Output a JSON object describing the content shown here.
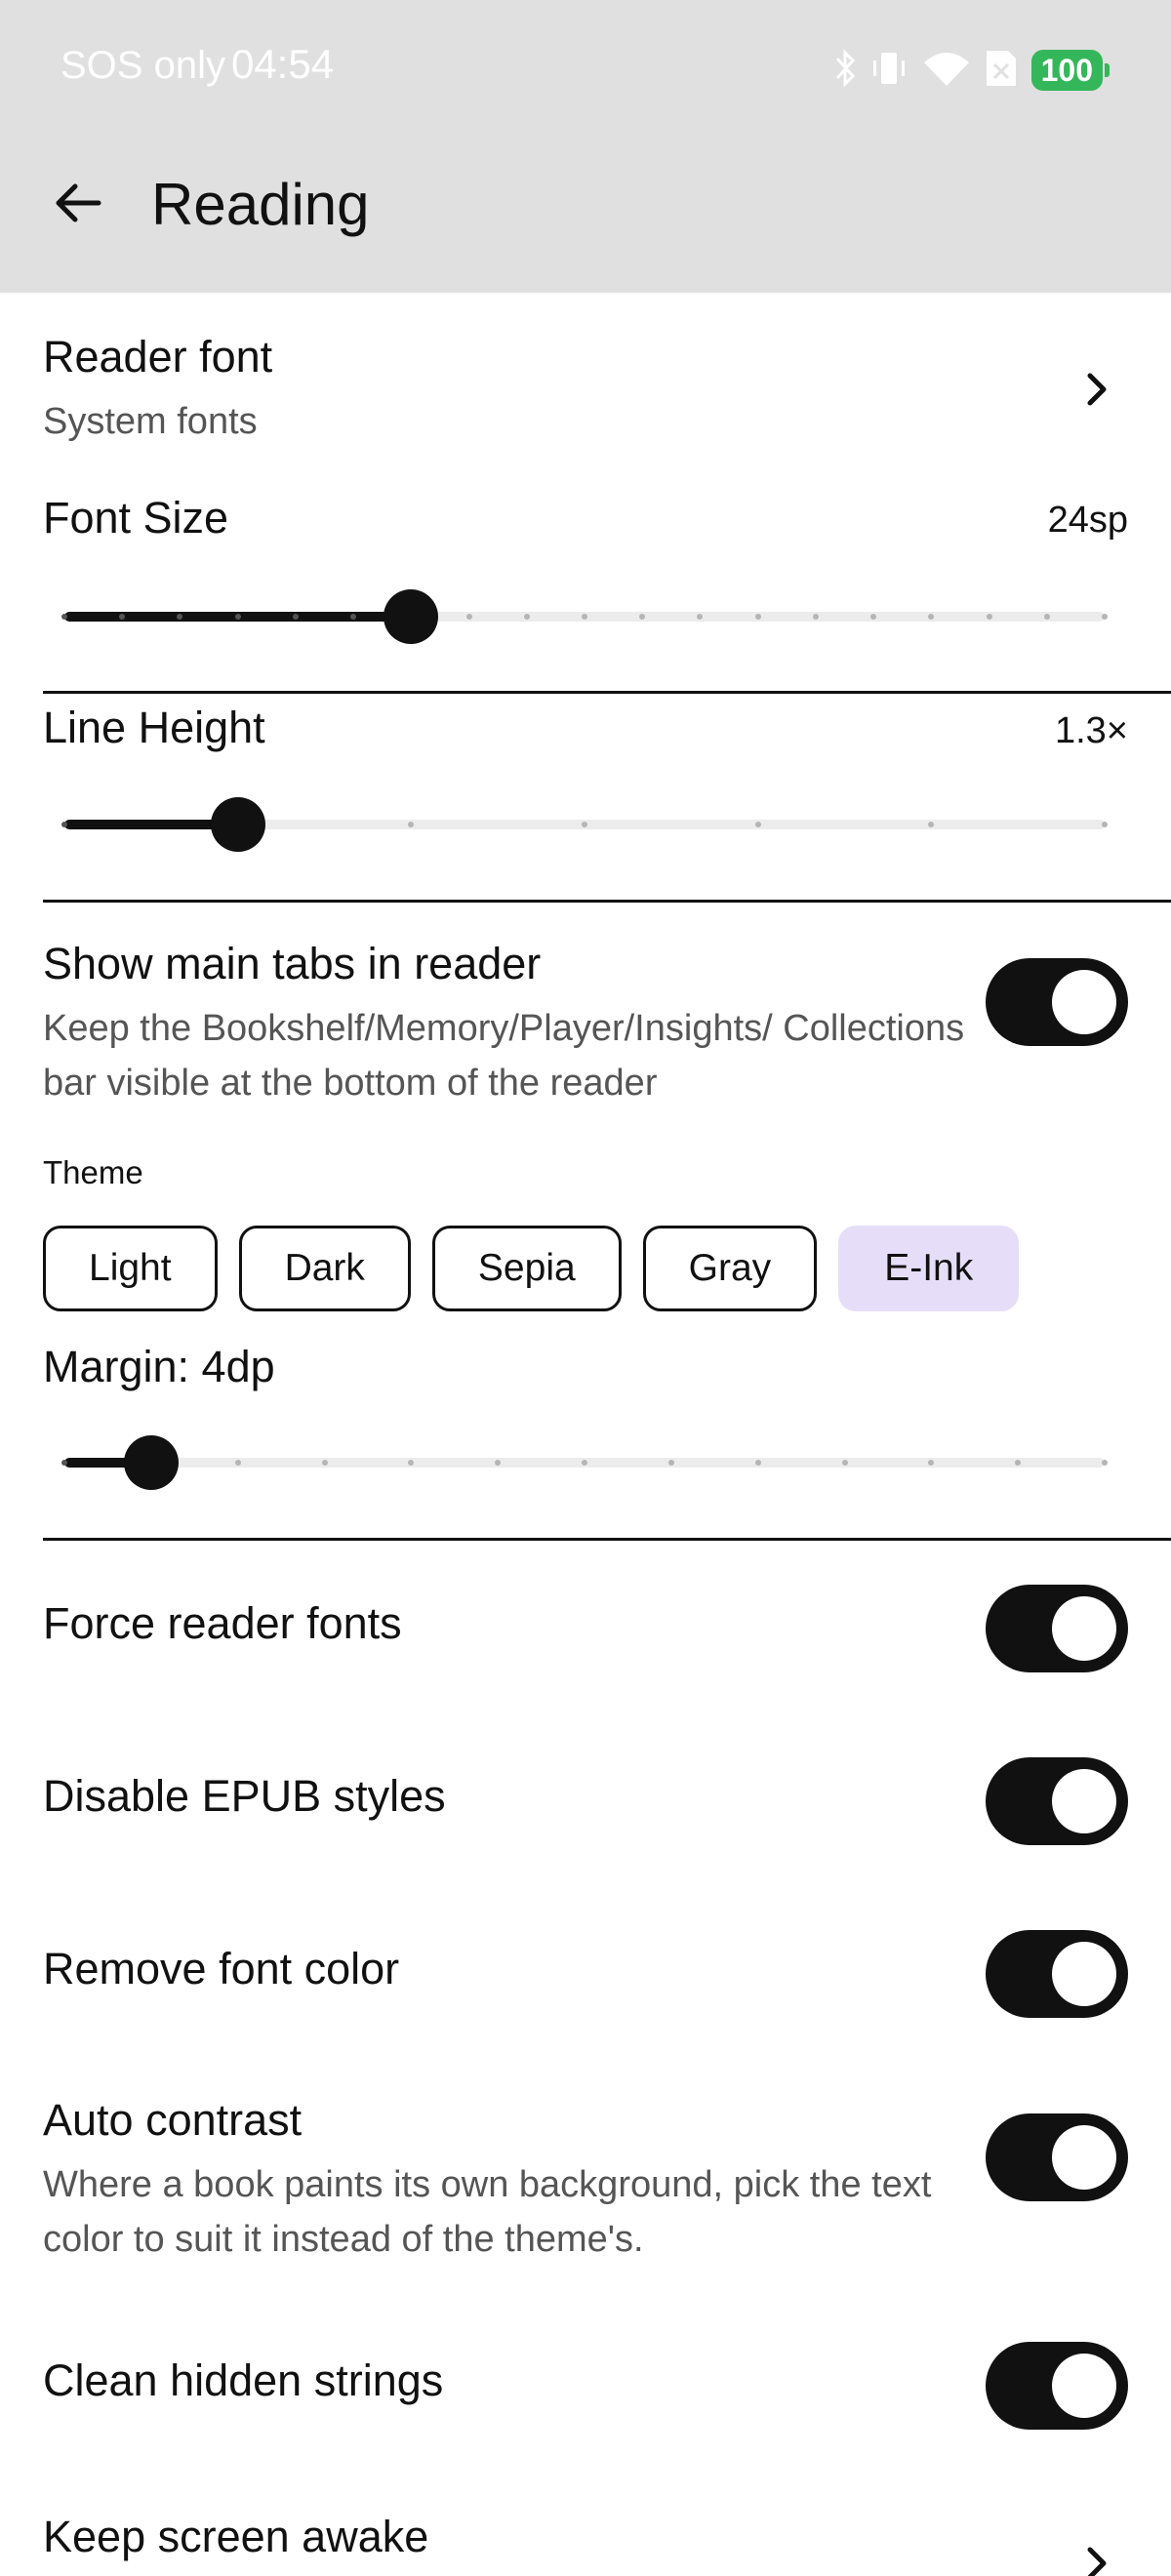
{
  "status_bar": {
    "carrier": "SOS only",
    "time": "04:54",
    "battery": "100"
  },
  "header": {
    "title": "Reading"
  },
  "reader_font": {
    "title": "Reader font",
    "subtitle": "System fonts"
  },
  "font_size": {
    "title": "Font Size",
    "value": "24sp",
    "slider": {
      "steps": 19,
      "current_index": 6
    }
  },
  "line_height": {
    "title": "Line Height",
    "value": "1.3×",
    "slider": {
      "steps": 7,
      "current_index": 1
    }
  },
  "show_main_tabs": {
    "title": "Show main tabs in reader",
    "subtitle": "Keep the Bookshelf/Memory/Player/Insights/ Collections bar visible at the bottom of the reader",
    "enabled": true
  },
  "theme": {
    "label": "Theme",
    "options": [
      "Light",
      "Dark",
      "Sepia",
      "Gray",
      "E-Ink"
    ],
    "selected": "E-Ink"
  },
  "margin": {
    "title": "Margin: 4dp",
    "slider": {
      "steps": 13,
      "current_index": 1
    }
  },
  "toggles": {
    "force_reader_fonts": {
      "title": "Force reader fonts",
      "enabled": true
    },
    "disable_epub_styles": {
      "title": "Disable EPUB styles",
      "enabled": true
    },
    "remove_font_color": {
      "title": "Remove font color",
      "enabled": true
    },
    "auto_contrast": {
      "title": "Auto contrast",
      "subtitle": "Where a book paints its own background, pick the text color to suit it instead of the theme's.",
      "enabled": true
    },
    "clean_hidden_strings": {
      "title": "Clean hidden strings",
      "enabled": true
    }
  },
  "keep_screen_awake": {
    "title": "Keep screen awake"
  },
  "colors": {
    "accent": "#111111",
    "chip_selected": "#e6def8",
    "header_bg": "#e0e0e0",
    "battery": "#33b75a"
  }
}
